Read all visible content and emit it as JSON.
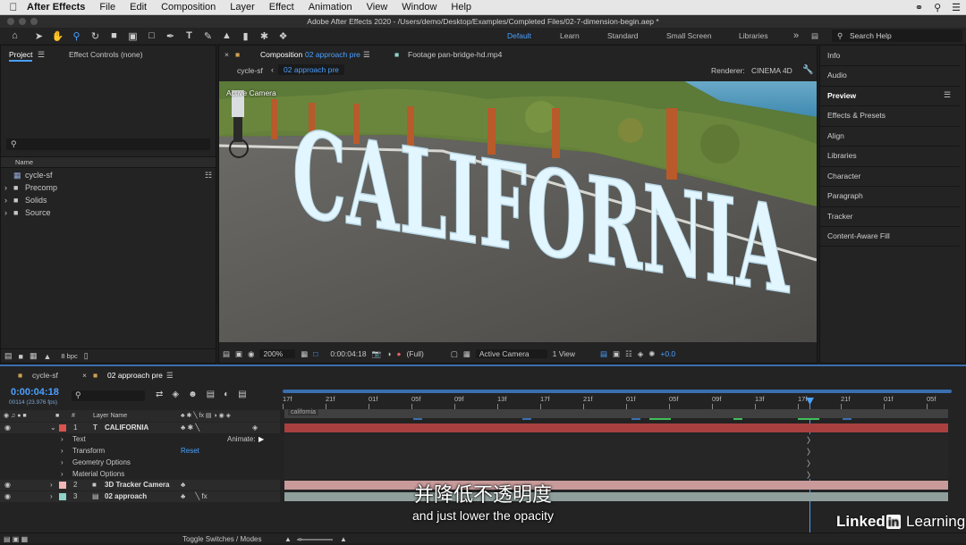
{
  "menubar": {
    "app": "After Effects",
    "items": [
      "File",
      "Edit",
      "Composition",
      "Layer",
      "Effect",
      "Animation",
      "View",
      "Window",
      "Help"
    ]
  },
  "window_title": "Adobe After Effects 2020 - /Users/demo/Desktop/Examples/Completed Files/02-7-dimension-begin.aep *",
  "workspaces": [
    "Default",
    "Learn",
    "Standard",
    "Small Screen",
    "Libraries"
  ],
  "search_help": "Search Help",
  "project_panel": {
    "tab_project": "Project",
    "tab_effect_controls": "Effect Controls (none)",
    "col_name": "Name",
    "items": [
      "cycle-sf",
      "Precomp",
      "Solids",
      "Source"
    ],
    "bpc": "8 bpc"
  },
  "viewer": {
    "tab_composition_prefix": "Composition",
    "tab_composition_name": "02 approach pre",
    "tab_footage": "Footage pan-bridge-hd.mp4",
    "breadcrumb_1": "cycle-sf",
    "breadcrumb_2": "02 approach pre",
    "renderer_label": "Renderer:",
    "renderer_value": "CINEMA 4D",
    "active_camera_overlay": "Active Camera",
    "scene_text": "CALIFORNIA",
    "zoom": "200%",
    "timecode": "0:00:04:18",
    "resolution": "(Full)",
    "camera_dropdown": "Active Camera",
    "view_dropdown": "1 View",
    "exposure": "+0.0"
  },
  "right_panel": {
    "items": [
      "Info",
      "Audio",
      "Preview",
      "Effects & Presets",
      "Align",
      "Libraries",
      "Character",
      "Paragraph",
      "Tracker",
      "Content-Aware Fill"
    ]
  },
  "timeline": {
    "tab_1": "cycle-sf",
    "tab_2": "02 approach pre",
    "timecode": "0:00:04:18",
    "frame_info": "00114 (23.976 fps)",
    "col_layer_name": "Layer Name",
    "col_hash": "#",
    "ruler_ticks": [
      "17f",
      "21f",
      "01f",
      "05f",
      "09f",
      "13f",
      "17f",
      "21f",
      "01f",
      "05f",
      "09f",
      "13f",
      "17f",
      "21f",
      "01f",
      "05f"
    ],
    "layers": [
      {
        "num": "1",
        "name": "CALIFORNIA",
        "type_icon": "T"
      },
      {
        "num": "2",
        "name": "3D Tracker Camera"
      },
      {
        "num": "3",
        "name": "02 approach"
      }
    ],
    "props": [
      "Text",
      "Transform",
      "Geometry Options",
      "Material Options"
    ],
    "animate_label": "Animate:",
    "reset_label": "Reset",
    "track_label": "california",
    "toggle_label": "Toggle Switches / Modes"
  },
  "subtitles": {
    "zh": "并降低不透明度",
    "en": "and just lower the opacity"
  },
  "watermark": {
    "linked": "Linked",
    "in": "in",
    "learning": "Learning"
  },
  "colors": {
    "accent_blue": "#4aa0ff",
    "track_red": "#a8403f",
    "track_pink": "#c89a9a",
    "layer_red": "#d9534f",
    "layer_pink": "#f0b8b8",
    "layer_teal": "#8fd3c6",
    "keyframe_green": "#3fbf5a"
  }
}
